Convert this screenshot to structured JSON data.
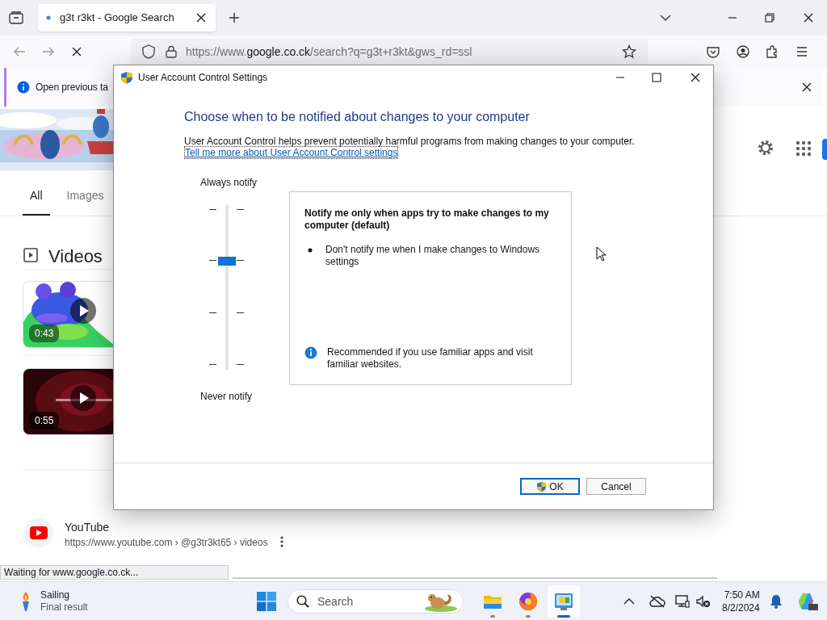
{
  "browser": {
    "tab": {
      "title": "g3t r3kt - Google Search"
    },
    "url": {
      "prefix": "https://www.",
      "domain": "google.co.ck",
      "path": "/search?q=g3t+r3kt&gws_rd=ssl"
    },
    "notification": {
      "text": "Open previous ta"
    },
    "status": "Waiting for www.google.co.ck..."
  },
  "google": {
    "tabs": [
      {
        "label": "All",
        "selected": true
      },
      {
        "label": "Images",
        "selected": false
      }
    ],
    "videos_heading": "Videos",
    "videos": [
      {
        "duration": "0:43",
        "kind": "green"
      },
      {
        "duration": "0:55",
        "kind": "dark"
      }
    ],
    "result": {
      "site": "YouTube",
      "url": "https://www.youtube.com › @g3tr3kt65 › videos"
    }
  },
  "dialog": {
    "title": "User Account Control Settings",
    "heading": "Choose when to be notified about changes to your computer",
    "description": "User Account Control helps prevent potentially harmful programs from making changes to your computer.",
    "link": "Tell me more about User Account Control settings",
    "top_label": "Always notify",
    "bottom_label": "Never notify",
    "slider": {
      "level": 0.667
    },
    "panel": {
      "title": "Notify me only when apps try to make changes to my computer (default)",
      "bullets": [
        "Don't notify me when I make changes to Windows settings"
      ],
      "note": "Recommended if you use familiar apps and visit familiar websites."
    },
    "buttons": [
      {
        "label": "OK",
        "kind": "shield"
      },
      {
        "label": "Cancel",
        "kind": "plain"
      }
    ]
  },
  "taskbar": {
    "weather": {
      "title": "Sailing",
      "subtitle": "Final result"
    },
    "search": {
      "placeholder": "Search"
    },
    "apps": [
      {
        "kind": "folder",
        "selected": false
      },
      {
        "kind": "firefox",
        "selected": false
      },
      {
        "kind": "control",
        "selected": true
      }
    ],
    "time": "7:50 AM",
    "date": "8/2/2024"
  }
}
